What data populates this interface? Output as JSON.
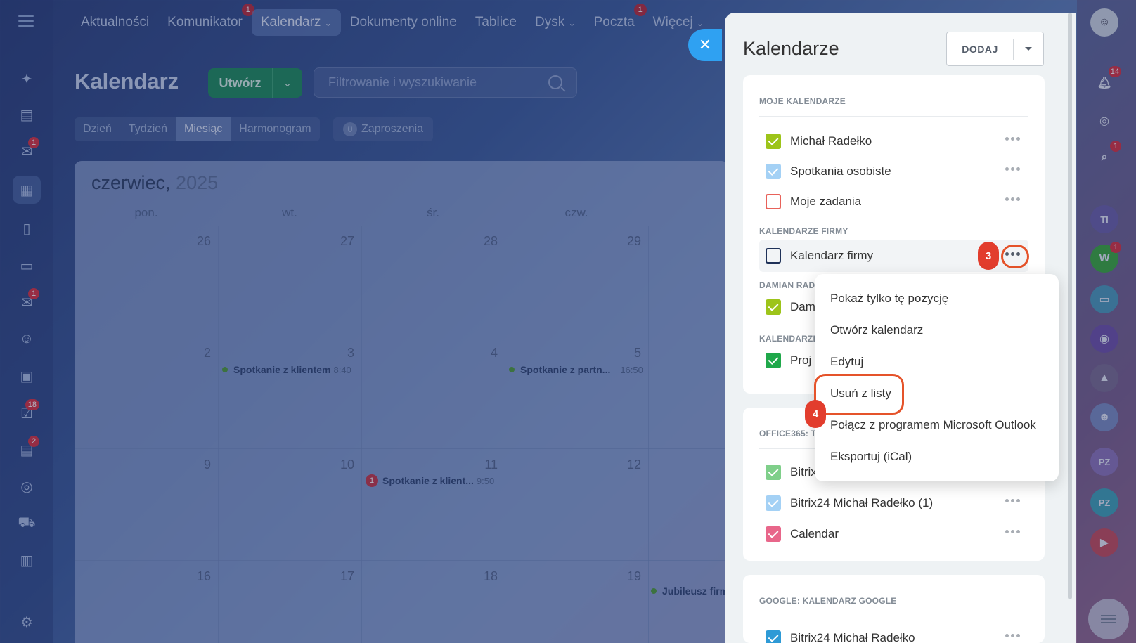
{
  "topnav": {
    "items": [
      {
        "label": "Aktualności",
        "badge": ""
      },
      {
        "label": "Komunikator",
        "badge": "1"
      },
      {
        "label": "Kalendarz",
        "badge": ""
      },
      {
        "label": "Dokumenty online",
        "badge": ""
      },
      {
        "label": "Tablice",
        "badge": ""
      },
      {
        "label": "Dysk",
        "badge": ""
      },
      {
        "label": "Poczta",
        "badge": "1"
      },
      {
        "label": "Więcej",
        "badge": ""
      }
    ]
  },
  "left_rail": {
    "badges": {
      "chat": "1",
      "mail": "1",
      "tasks": "18",
      "feed": "2"
    }
  },
  "page": {
    "title": "Kalendarz",
    "create_label": "Utwórz",
    "search_placeholder": "Filtrowanie i wyszukiwanie",
    "view_tabs": [
      "Dzień",
      "Tydzień",
      "Miesiąc",
      "Harmonogram"
    ],
    "active_tab": "Miesiąc",
    "invites_count": "0",
    "invites_label": "Zaproszenia"
  },
  "calendar": {
    "month": "czerwiec,",
    "year": "2025",
    "weekdays": [
      "pon.",
      "wt.",
      "śr.",
      "czw."
    ],
    "weeks": [
      [
        "26",
        "27",
        "28",
        "29"
      ],
      [
        "2",
        "3",
        "4",
        "5"
      ],
      [
        "9",
        "10",
        "11",
        "12"
      ],
      [
        "16",
        "17",
        "18",
        "19"
      ]
    ],
    "events": [
      {
        "title": "Spotkanie z klientem",
        "time": "8:40",
        "badge": ""
      },
      {
        "title": "Spotkanie z partn...",
        "time": "16:50",
        "badge": ""
      },
      {
        "title": "Spotkanie z klient...",
        "time": "9:50",
        "badge": "1"
      },
      {
        "title": "Jubileusz firm",
        "time": "",
        "badge": ""
      }
    ]
  },
  "right_rail": {
    "notifications_badge": "14",
    "chat_badge": "1",
    "w_label": "W",
    "w_badge": "1",
    "pz1": "PZ",
    "pz2": "PZ",
    "ti": "TI"
  },
  "panel": {
    "title": "Kalendarze",
    "add_label": "DODAJ",
    "sections": {
      "my": "MOJE KALENDARZE",
      "company": "KALENDARZE FIRMY",
      "damian": "DAMIAN RAD",
      "other": "KALENDARZE",
      "office": "OFFICE365: TA",
      "google": "GOOGLE: KALENDARZ GOOGLE"
    },
    "my_calendars": [
      "Michał Radełko",
      "Spotkania osobiste",
      "Moje zadania"
    ],
    "company_calendars": [
      "Kalendarz firmy"
    ],
    "damian_calendars": [
      "Dam"
    ],
    "other_calendars": [
      "Proj"
    ],
    "office_calendars": [
      "Bitrix",
      "Bitrix24 Michał Radełko (1)",
      "Calendar"
    ],
    "google_calendars": [
      "Bitrix24 Michał Radełko"
    ],
    "colors": {
      "green": "#9dc41a",
      "lightblue": "#a4d1f5",
      "red_outline": "#e8625a",
      "navy_outline": "#1f3158",
      "pink": "#e8668a",
      "mint": "#7fcf8a",
      "blue": "#2e9ad6"
    }
  },
  "menu": {
    "items": [
      "Pokaż tylko tę pozycję",
      "Otwórz kalendarz",
      "Edytuj",
      "Usuń z listy",
      "Połącz z programem Microsoft Outlook",
      "Eksportuj (iCal)"
    ]
  },
  "steps": {
    "s3": "3",
    "s4": "4"
  }
}
